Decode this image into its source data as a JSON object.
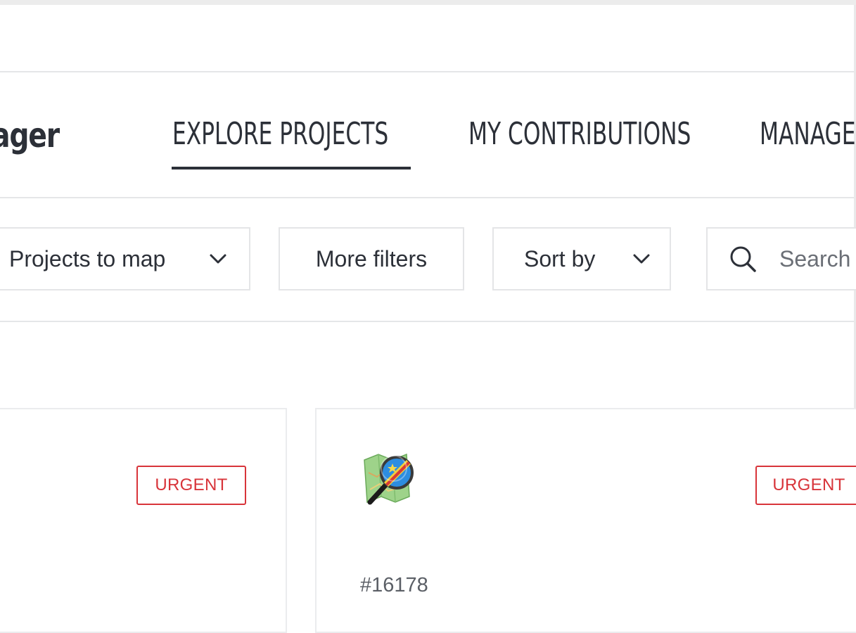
{
  "header": {
    "logo_text": "ager",
    "tabs": [
      {
        "label": "EXPLORE PROJECTS",
        "active": true
      },
      {
        "label": "MY CONTRIBUTIONS",
        "active": false
      },
      {
        "label": "MANAGE",
        "active": false
      }
    ]
  },
  "filters": {
    "projects_dropdown": "Projects to map",
    "more_filters": "More filters",
    "sort_by": "Sort by",
    "search_placeholder": "Search"
  },
  "cards": [
    {
      "badge": "URGENT"
    },
    {
      "badge": "URGENT",
      "project_id": "#16178",
      "logo_icon": "osm-magnifier-logo"
    }
  ],
  "colors": {
    "text": "#2c3038",
    "urgent": "#d8343a",
    "border": "#e4e5e7"
  }
}
